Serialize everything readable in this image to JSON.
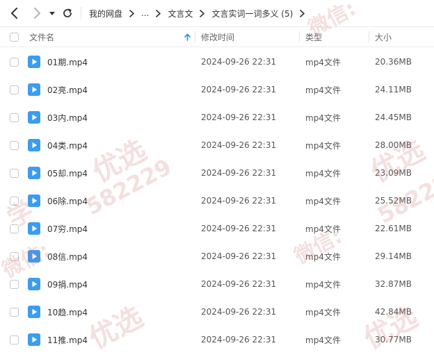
{
  "breadcrumb": {
    "root": "我的网盘",
    "ellipsis": "...",
    "parent": "文言文",
    "current": "文言实词一词多义 (5)"
  },
  "columns": {
    "name": "文件名",
    "modified": "修改时间",
    "type": "类型",
    "size": "大小"
  },
  "files": [
    {
      "name": "01期.mp4",
      "modified": "2024-09-26 22:31",
      "type": "mp4文件",
      "size": "20.36MB"
    },
    {
      "name": "02亮.mp4",
      "modified": "2024-09-26 22:31",
      "type": "mp4文件",
      "size": "24.11MB"
    },
    {
      "name": "03内.mp4",
      "modified": "2024-09-26 22:31",
      "type": "mp4文件",
      "size": "24.45MB"
    },
    {
      "name": "04类.mp4",
      "modified": "2024-09-26 22:31",
      "type": "mp4文件",
      "size": "28.00MB"
    },
    {
      "name": "05却.mp4",
      "modified": "2024-09-26 22:31",
      "type": "mp4文件",
      "size": "23.09MB"
    },
    {
      "name": "06除.mp4",
      "modified": "2024-09-26 22:31",
      "type": "mp4文件",
      "size": "25.52MB"
    },
    {
      "name": "07穷.mp4",
      "modified": "2024-09-26 22:31",
      "type": "mp4文件",
      "size": "22.61MB"
    },
    {
      "name": "08信.mp4",
      "modified": "2024-09-26 22:31",
      "type": "mp4文件",
      "size": "29.14MB"
    },
    {
      "name": "09捐.mp4",
      "modified": "2024-09-26 22:31",
      "type": "mp4文件",
      "size": "32.87MB"
    },
    {
      "name": "10趋.mp4",
      "modified": "2024-09-26 22:31",
      "type": "mp4文件",
      "size": "42.84MB"
    },
    {
      "name": "11推.mp4",
      "modified": "2024-09-26 22:31",
      "type": "mp4文件",
      "size": "30.77MB"
    }
  ],
  "watermark": {
    "text_a": "学",
    "text_b": "微信:",
    "text_c": "优选",
    "text_d": "582229"
  },
  "colors": {
    "accent": "#1e90ff",
    "file_icon": "#3c9cf0",
    "watermark": "#cd6e6e"
  }
}
